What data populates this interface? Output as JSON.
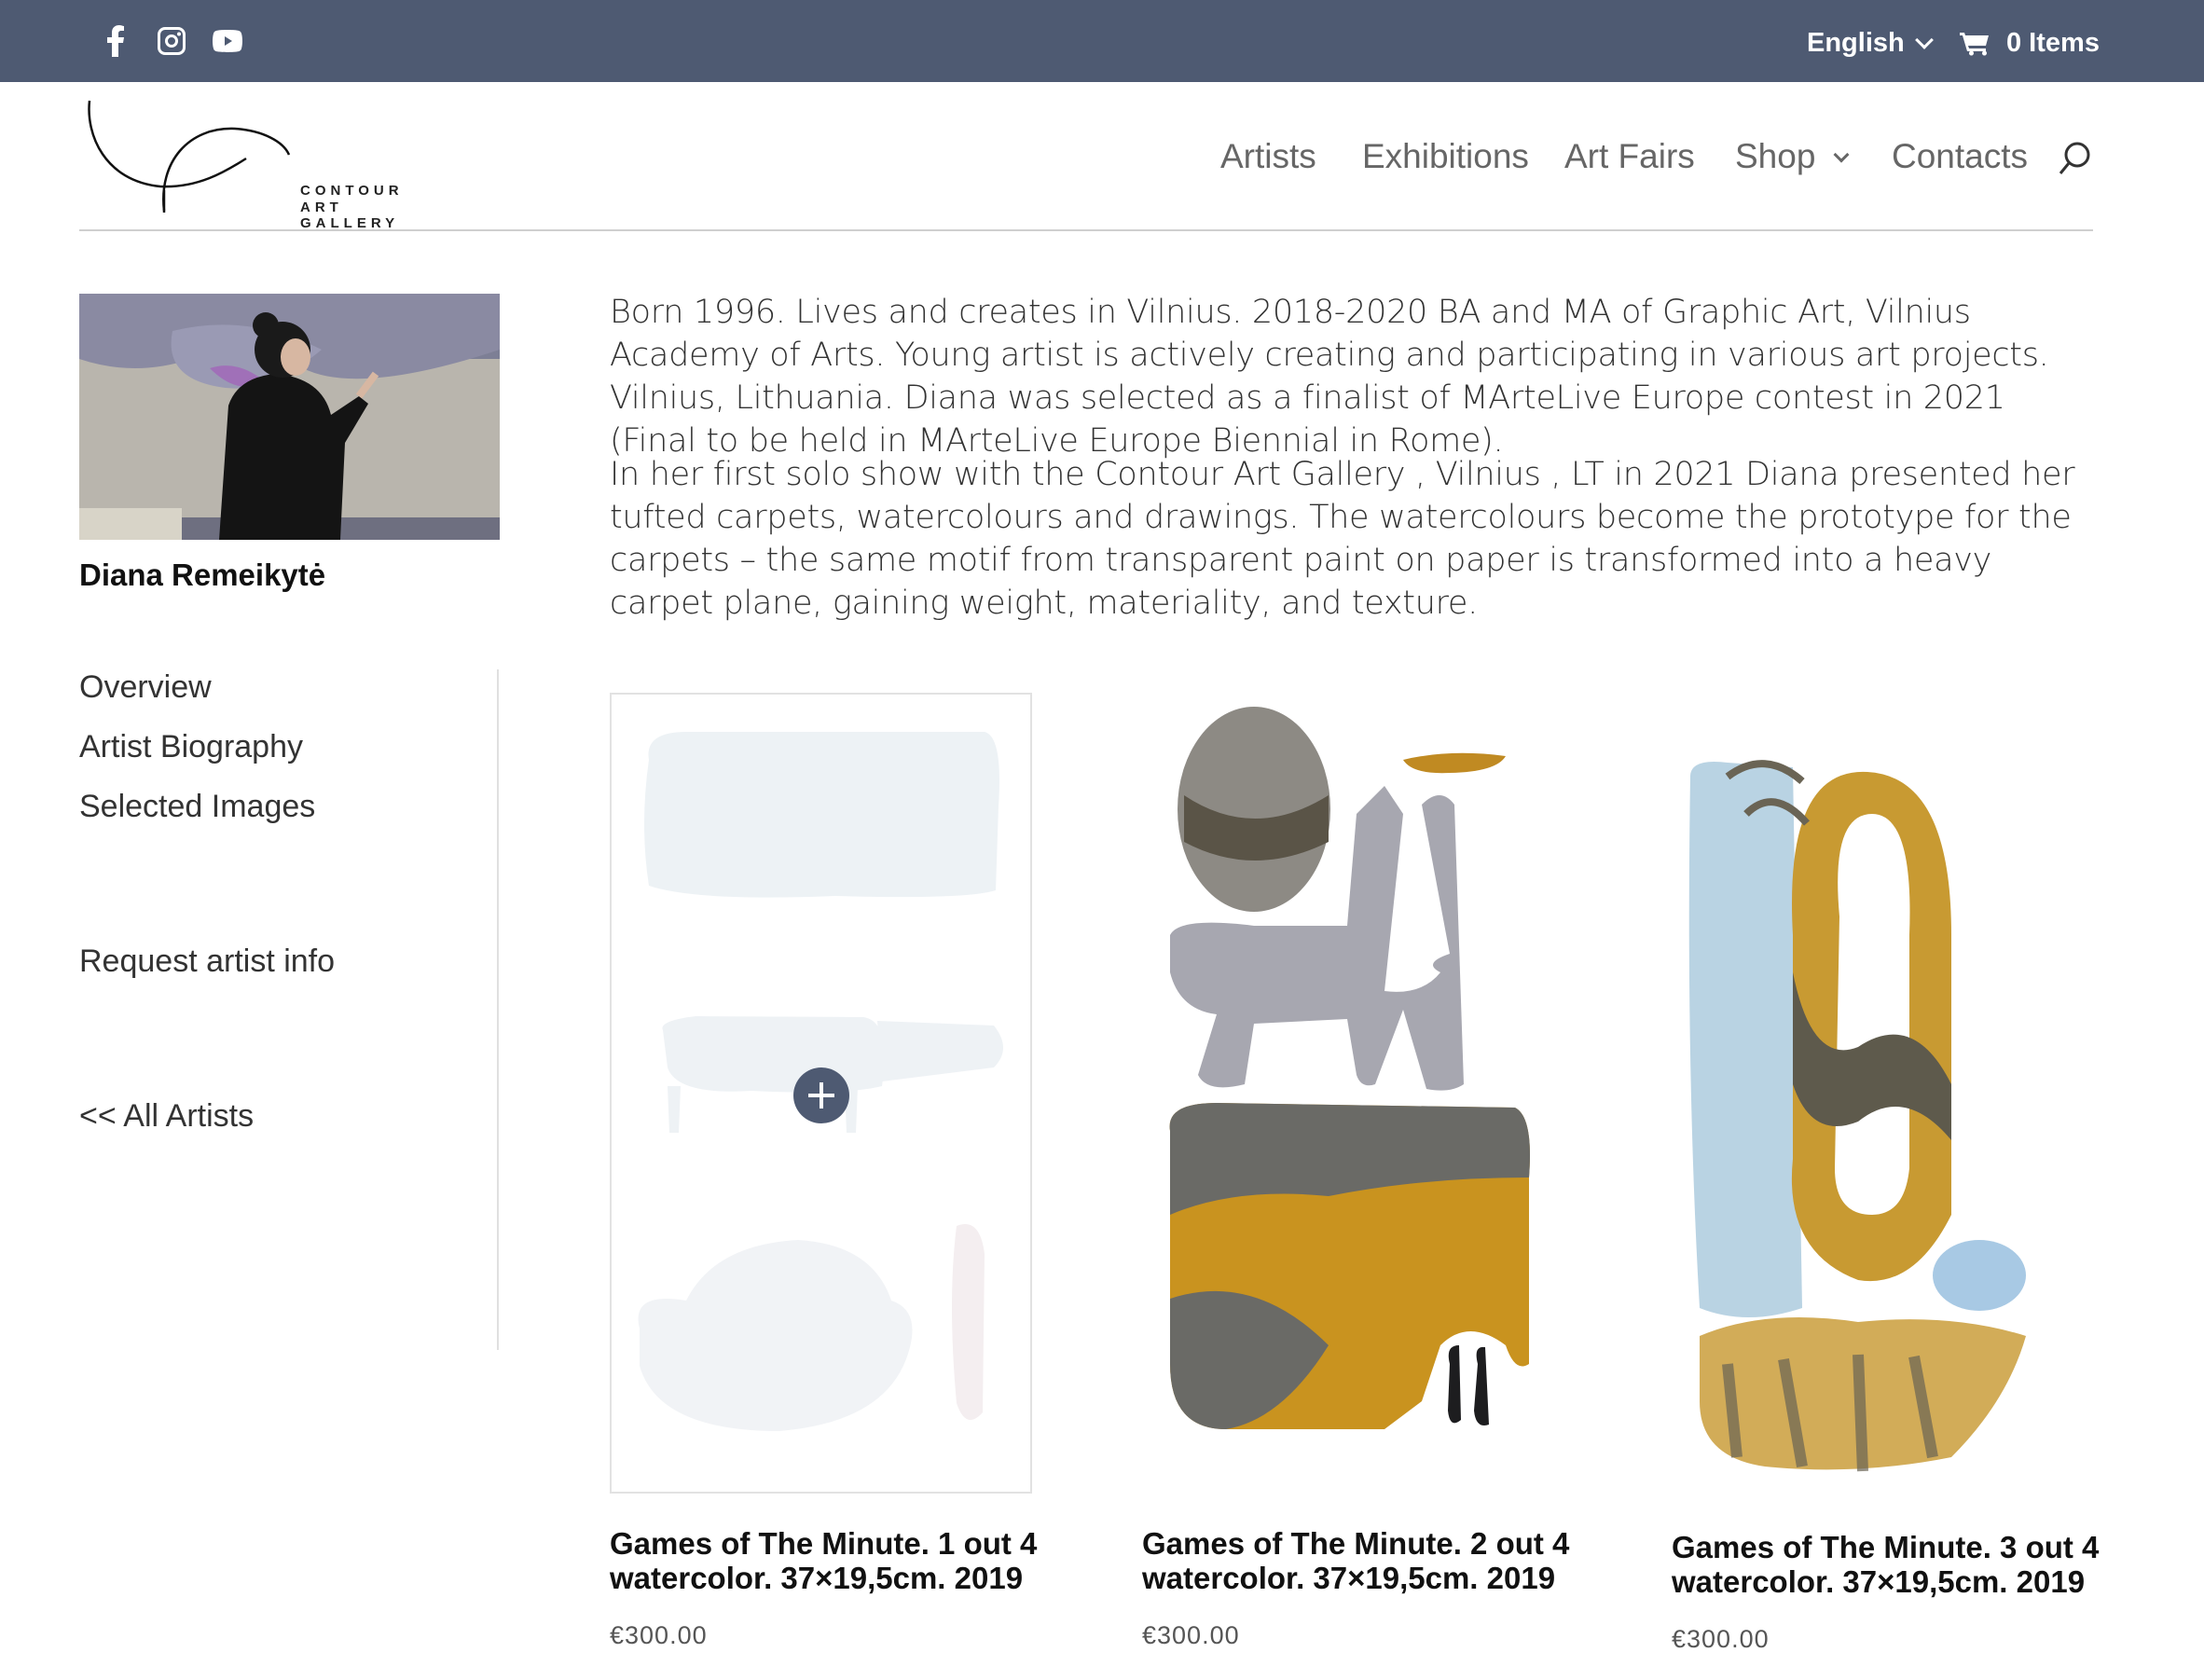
{
  "topbar": {
    "social": [
      {
        "name": "facebook-icon"
      },
      {
        "name": "instagram-icon"
      },
      {
        "name": "youtube-icon"
      }
    ],
    "language": "English",
    "cart_label": "0 Items"
  },
  "logo": {
    "line1": "CONTOUR",
    "line2": "ART GALLERY"
  },
  "nav": {
    "items": [
      {
        "label": "Artists"
      },
      {
        "label": "Exhibitions"
      },
      {
        "label": "Art Fairs"
      },
      {
        "label": "Shop"
      },
      {
        "label": "Contacts"
      }
    ]
  },
  "artist": {
    "name": "Diana Remeikytė"
  },
  "sidebar": {
    "links": [
      {
        "label": "Overview"
      },
      {
        "label": "Artist Biography"
      },
      {
        "label": "Selected Images"
      },
      {
        "label": "Request artist info"
      },
      {
        "label": "<< All Artists"
      }
    ]
  },
  "bio": {
    "p1": "Born 1996. Lives and creates in Vilnius. 2018-2020 BA and MA of Graphic Art, Vilnius Academy of Arts. Young artist is actively creating and participating in various art projects. Vilnius, Lithuania. Diana was selected as a finalist of MArteLive Europe contest in 2021 (Final to be held in MArteLive Europe Biennial in Rome).",
    "p2": "In her first solo show with the Contour Art Gallery , Vilnius , LT in 2021 Diana presented her tufted carpets, watercolours and drawings. The watercolours become the prototype for the carpets – the same motif from transparent paint on paper is transformed into a heavy carpet plane, gaining weight, materiality, and texture."
  },
  "products": [
    {
      "title_line1": "Games of The Minute. 1 out 4",
      "title_line2": "watercolor. 37×19,5cm. 2019",
      "price": "€300.00"
    },
    {
      "title_line1": "Games of The Minute. 2 out 4",
      "title_line2": "watercolor. 37×19,5cm. 2019",
      "price": "€300.00"
    },
    {
      "title_line1": "Games of The Minute. 3 out 4",
      "title_line2": "watercolor. 37×19,5cm. 2019",
      "price": "€300.00"
    }
  ],
  "colors": {
    "topbar": "#4e5a72",
    "accent": "#4e5a72"
  }
}
